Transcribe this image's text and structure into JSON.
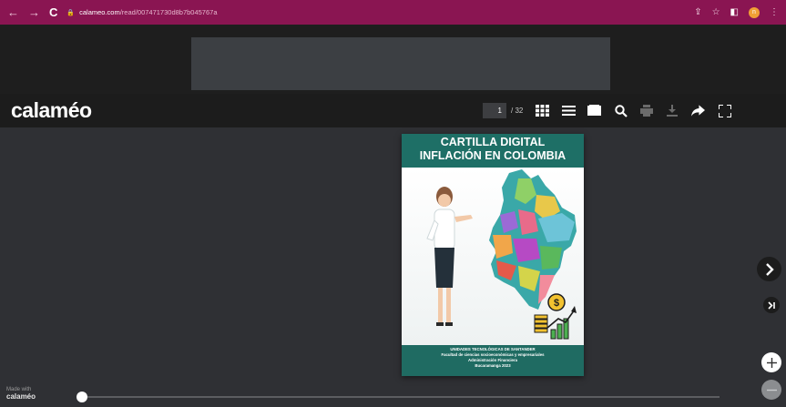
{
  "browser": {
    "url_host": "calameo.com",
    "url_path": "/read/007471730d8b7b045767a",
    "profile_initial": "n",
    "accent": "#8a1552"
  },
  "header": {
    "logo": "calaméo",
    "current_page": "1",
    "total_pages": "/ 32"
  },
  "cover": {
    "title_line1": "CARTILLA DIGITAL",
    "title_line2": "INFLACIÓN EN COLOMBIA",
    "footer_lines": [
      "UNIDADES TECNOLÓGICAS DE SANTANDER",
      "Facultad de ciencias socioeconómicas y empresariales",
      "Administración Financiera",
      "Bucaramanga 2023"
    ],
    "accent": "#1e6f66"
  },
  "footer": {
    "made_with": "Made with",
    "brand": "calaméo",
    "progress": 0
  },
  "icons": {
    "back": "arrow-left-icon",
    "forward": "arrow-right-icon",
    "reload": "reload-icon",
    "grid": "grid-icon",
    "list": "list-icon",
    "book": "book-icon",
    "search": "search-icon",
    "print": "print-icon",
    "download": "download-icon",
    "share": "share-icon",
    "fullscreen": "fullscreen-icon"
  }
}
